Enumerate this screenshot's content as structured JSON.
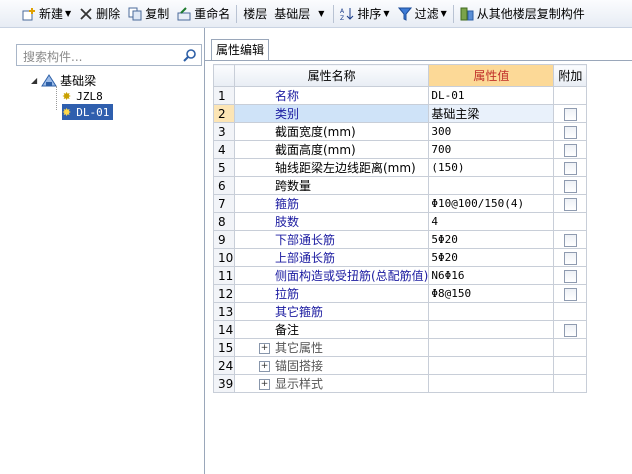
{
  "toolbar": {
    "new_label": "新建",
    "delete_label": "删除",
    "copy_label": "复制",
    "rename_label": "重命名",
    "floor_label": "楼层",
    "floor_value": "基础层",
    "sort_label": "排序",
    "filter_label": "过滤",
    "copy_from_floor_label": "从其他楼层复制构件"
  },
  "search": {
    "placeholder": "搜索构件..."
  },
  "tree": {
    "root": "基础梁",
    "children": [
      "JZL8",
      "DL-01"
    ],
    "selected": "DL-01"
  },
  "tab": {
    "label": "属性编辑"
  },
  "table": {
    "headers": {
      "name": "属性名称",
      "value": "属性值",
      "extra": "附加"
    },
    "rows": [
      {
        "num": "1",
        "name": "名称",
        "value": "DL-01"
      },
      {
        "num": "2",
        "name": "类别",
        "value": "基础主梁"
      },
      {
        "num": "3",
        "name": "截面宽度(mm)",
        "value": "300"
      },
      {
        "num": "4",
        "name": "截面高度(mm)",
        "value": "700"
      },
      {
        "num": "5",
        "name": "轴线距梁左边线距离(mm)",
        "value": "(150)"
      },
      {
        "num": "6",
        "name": "跨数量",
        "value": ""
      },
      {
        "num": "7",
        "name": "箍筋",
        "value": "Φ10@100/150(4)"
      },
      {
        "num": "8",
        "name": "肢数",
        "value": "4"
      },
      {
        "num": "9",
        "name": "下部通长筋",
        "value": "5Φ20"
      },
      {
        "num": "10",
        "name": "上部通长筋",
        "value": "5Φ20"
      },
      {
        "num": "11",
        "name": "侧面构造或受扭筋(总配筋值)",
        "value": "N6Φ16"
      },
      {
        "num": "12",
        "name": "拉筋",
        "value": "Φ8@150"
      },
      {
        "num": "13",
        "name": "其它箍筋",
        "value": ""
      },
      {
        "num": "14",
        "name": "备注",
        "value": ""
      },
      {
        "num": "15",
        "name": "其它属性",
        "value": ""
      },
      {
        "num": "24",
        "name": "锚固搭接",
        "value": ""
      },
      {
        "num": "39",
        "name": "显示样式",
        "value": ""
      }
    ]
  }
}
